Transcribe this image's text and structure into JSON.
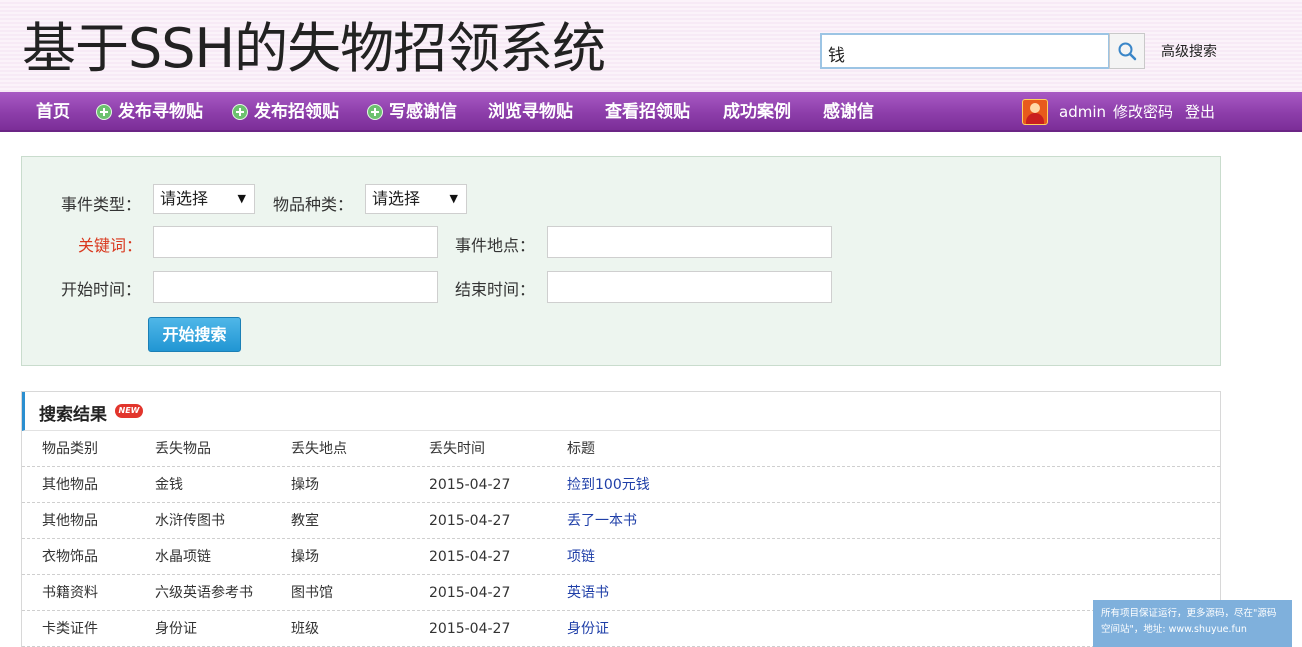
{
  "header": {
    "site_title": "基于SSH的失物招领系统",
    "search_value": "钱",
    "advanced_search": "高级搜索"
  },
  "nav": {
    "items": [
      {
        "label": "首页",
        "plus": false
      },
      {
        "label": "发布寻物贴",
        "plus": true
      },
      {
        "label": "发布招领贴",
        "plus": true
      },
      {
        "label": "写感谢信",
        "plus": true
      },
      {
        "label": "浏览寻物贴",
        "plus": false
      },
      {
        "label": "查看招领贴",
        "plus": false
      },
      {
        "label": "成功案例",
        "plus": false
      },
      {
        "label": "感谢信",
        "plus": false
      }
    ],
    "username": "admin",
    "change_password": "修改密码",
    "logout": "登出"
  },
  "filters": {
    "event_type_label": "事件类型：",
    "event_type_value": "请选择",
    "item_kind_label": "物品种类：",
    "item_kind_value": "请选择",
    "keyword_label": "关键词：",
    "location_label": "事件地点：",
    "start_time_label": "开始时间：",
    "end_time_label": "结束时间：",
    "search_button": "开始搜索"
  },
  "results": {
    "title": "搜索结果",
    "badge": "NEW",
    "columns": [
      "物品类别",
      "丢失物品",
      "丢失地点",
      "丢失时间",
      "标题"
    ],
    "rows": [
      [
        "其他物品",
        "金钱",
        "操场",
        "2015-04-27",
        "捡到100元钱"
      ],
      [
        "其他物品",
        "水浒传图书",
        "教室",
        "2015-04-27",
        "丢了一本书"
      ],
      [
        "衣物饰品",
        "水晶项链",
        "操场",
        "2015-04-27",
        "项链"
      ],
      [
        "书籍资料",
        "六级英语参考书",
        "图书馆",
        "2015-04-27",
        "英语书"
      ],
      [
        "卡类证件",
        "身份证",
        "班级",
        "2015-04-27",
        "身份证"
      ]
    ]
  },
  "watermark": {
    "line1": "所有项目保证运行，更多源码，尽在\"源码",
    "line2": "空间站\"，地址: www.shuyue.fun"
  }
}
